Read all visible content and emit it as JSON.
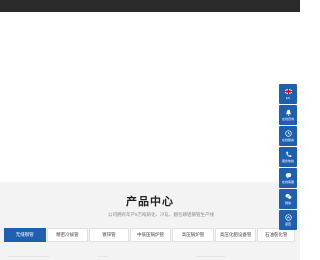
{
  "section": {
    "title": "产品中心",
    "subtitle": "公司拥有年产5万吨硝化、冷轧、翻包磷铝钢管生产线"
  },
  "tabs": [
    {
      "label": "无缝钢管",
      "active": true
    },
    {
      "label": "精密冷拔管",
      "active": false
    },
    {
      "label": "镀锌管",
      "active": false
    },
    {
      "label": "中低压锅炉管",
      "active": false
    },
    {
      "label": "高压锅炉管",
      "active": false
    },
    {
      "label": "高压化肥设备管",
      "active": false
    },
    {
      "label": "石油裂化管",
      "active": false
    }
  ],
  "float_bar": [
    {
      "icon": "flag-icon",
      "label": "EN"
    },
    {
      "icon": "bell-icon",
      "label": "在线咨询"
    },
    {
      "icon": "clock-icon",
      "label": "在线留言"
    },
    {
      "icon": "phone-icon",
      "label": "服务热线"
    },
    {
      "icon": "chat-icon",
      "label": "在线客服"
    },
    {
      "icon": "wechat-icon",
      "label": "微信"
    },
    {
      "icon": "arrow-up-icon",
      "label": "返回"
    }
  ],
  "colors": {
    "accent": "#1e5fb0",
    "topbar": "#2b2b2b",
    "section_bg": "#f3f3f3"
  }
}
